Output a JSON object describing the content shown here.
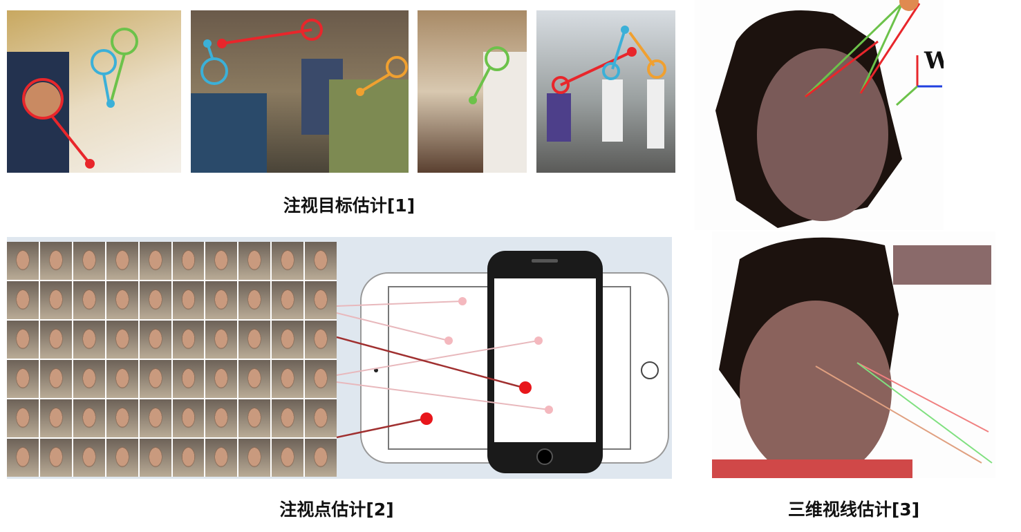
{
  "captions": {
    "gaze_target": "注视目标估计[1]",
    "gaze_point": "注视点估计[2]",
    "gaze_3d": "三维视线估计[3]"
  },
  "wcs_label": "WCS",
  "colors": {
    "red": "#e8262b",
    "green": "#6cc24a",
    "cyan": "#3bb0d8",
    "orange": "#f0a030",
    "panel": "#dfe7ef"
  }
}
